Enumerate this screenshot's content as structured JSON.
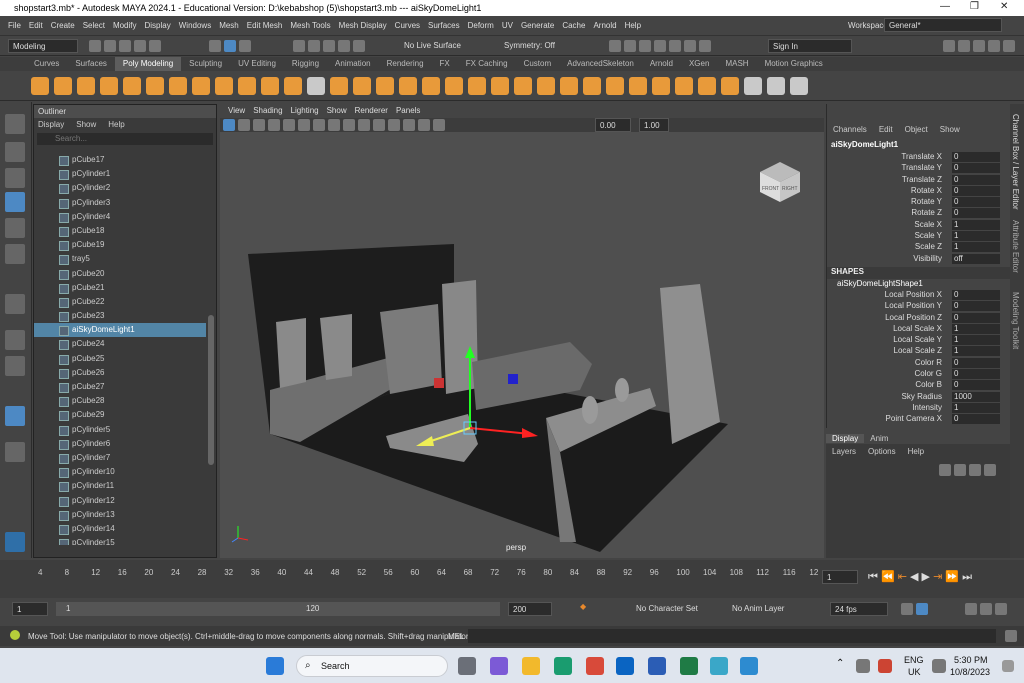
{
  "title": "shopstart3.mb* - Autodesk MAYA 2024.1 - Educational Version: D:\\kebabshop (5)\\shopstart3.mb   ---   aiSkyDomeLight1",
  "menus": [
    "File",
    "Edit",
    "Create",
    "Select",
    "Modify",
    "Display",
    "Windows",
    "Mesh",
    "Edit Mesh",
    "Mesh Tools",
    "Mesh Display",
    "Curves",
    "Surfaces",
    "Deform",
    "UV",
    "Generate",
    "Cache",
    "Arnold",
    "Help"
  ],
  "workspace_label": "Workspace:",
  "workspace": "General*",
  "mode": "Modeling",
  "live_surface": "No Live Surface",
  "symmetry": "Symmetry: Off",
  "sign_in": "Sign In",
  "shelf_tabs": [
    "Curves",
    "Surfaces",
    "Poly Modeling",
    "Sculpting",
    "UV Editing",
    "Rigging",
    "Animation",
    "Rendering",
    "FX",
    "FX Caching",
    "Custom",
    "AdvancedSkeleton",
    "Arnold",
    "XGen",
    "MASH",
    "Motion Graphics"
  ],
  "outliner": {
    "title": "Outliner",
    "menus": [
      "Display",
      "Show",
      "Help"
    ],
    "search": "Search...",
    "items": [
      "pCube17",
      "pCylinder1",
      "pCylinder2",
      "pCylinder3",
      "pCylinder4",
      "pCube18",
      "pCube19",
      "tray5",
      "pCube20",
      "pCube21",
      "pCube22",
      "pCube23",
      "aiSkyDomeLight1",
      "pCube24",
      "pCube25",
      "pCube26",
      "pCube27",
      "pCube28",
      "pCube29",
      "pCylinder5",
      "pCylinder6",
      "pCylinder7",
      "pCylinder10",
      "pCylinder11",
      "pCylinder12",
      "pCylinder13",
      "pCylinder14",
      "pCylinder15"
    ]
  },
  "viewport": {
    "menus": [
      "View",
      "Shading",
      "Lighting",
      "Show",
      "Renderer",
      "Panels"
    ],
    "val1": "0.00",
    "val2": "1.00",
    "camera": "persp",
    "cube_front": "FRONT",
    "cube_right": "RIGHT"
  },
  "channel_box": {
    "menus": [
      "Channels",
      "Edit",
      "Object",
      "Show"
    ],
    "object": "aiSkyDomeLight1",
    "attrs": [
      [
        "Translate X",
        "0"
      ],
      [
        "Translate Y",
        "0"
      ],
      [
        "Translate Z",
        "0"
      ],
      [
        "Rotate X",
        "0"
      ],
      [
        "Rotate Y",
        "0"
      ],
      [
        "Rotate Z",
        "0"
      ],
      [
        "Scale X",
        "1"
      ],
      [
        "Scale Y",
        "1"
      ],
      [
        "Scale Z",
        "1"
      ],
      [
        "Visibility",
        "off"
      ]
    ],
    "shapes_label": "SHAPES",
    "shape": "aiSkyDomeLightShape1",
    "shape_attrs": [
      [
        "Local Position X",
        "0"
      ],
      [
        "Local Position Y",
        "0"
      ],
      [
        "Local Position Z",
        "0"
      ],
      [
        "Local Scale X",
        "1"
      ],
      [
        "Local Scale Y",
        "1"
      ],
      [
        "Local Scale Z",
        "1"
      ],
      [
        "Color R",
        "0"
      ],
      [
        "Color G",
        "0"
      ],
      [
        "Color B",
        "0"
      ],
      [
        "Sky Radius",
        "1000"
      ],
      [
        "Intensity",
        "1"
      ],
      [
        "Point Camera X",
        "0"
      ]
    ]
  },
  "side_tabs": [
    "Channel Box / Layer Editor",
    "Attribute Editor",
    "Modeling Toolkit"
  ],
  "layer": {
    "tabs": [
      "Display",
      "Anim"
    ],
    "menus": [
      "Layers",
      "Options",
      "Help"
    ]
  },
  "timeline": {
    "ticks": [
      "4",
      "8",
      "12",
      "16",
      "20",
      "24",
      "28",
      "32",
      "36",
      "40",
      "44",
      "48",
      "52",
      "56",
      "60",
      "64",
      "68",
      "72",
      "76",
      "80",
      "84",
      "88",
      "92",
      "96",
      "100",
      "104",
      "108",
      "112",
      "116",
      "12"
    ],
    "current": "1"
  },
  "range": {
    "start": "1",
    "inner_start": "1",
    "inner_end": "120",
    "end": "200",
    "character": "No Character Set",
    "anim_layer": "No Anim Layer",
    "fps": "24 fps"
  },
  "help_line": "Move Tool: Use manipulator to move object(s). Ctrl+middle-drag to move components along normals. Shift+drag manipulator axis",
  "mel": "MEL",
  "taskbar": {
    "search": "Search",
    "lang": "ENG",
    "region": "UK",
    "time": "5:30 PM",
    "date": "10/8/2023"
  }
}
